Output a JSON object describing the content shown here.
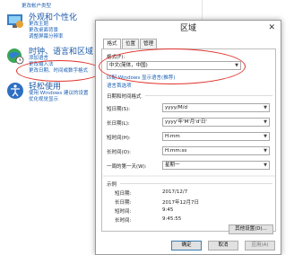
{
  "control_panel": {
    "top_link": "更改帐户类型",
    "appearance": {
      "title": "外观和个性化",
      "links": [
        "更改主题",
        "更改桌面背景",
        "调整屏幕分辨率"
      ]
    },
    "clock": {
      "title": "时钟、语言和区域",
      "links": [
        "添加语言",
        "更改输入法",
        "更改日期、时间或数字格式"
      ]
    },
    "ease": {
      "title": "轻松使用",
      "links": [
        "使用 Windows 建议的设置",
        "优化视觉显示"
      ]
    }
  },
  "dialog": {
    "title": "区域",
    "close_glyph": "✕",
    "tabs": [
      "格式",
      "位置",
      "管理"
    ],
    "format_label": "格式(F):",
    "format_value": "中文(简体，中国)",
    "match_link": "匹配 Windows 显示语言(推荐)",
    "lang_pref_link": "语言首选项",
    "datetime_group": "日期和时间格式",
    "fields": [
      {
        "label": "短日期(S):",
        "value": "yyyy/M/d"
      },
      {
        "label": "长日期(L):",
        "value": "yyyy'年'M'月'd'日'"
      },
      {
        "label": "短时间(H):",
        "value": "H:mm"
      },
      {
        "label": "长时间(O):",
        "value": "H:mm:ss"
      },
      {
        "label": "一周的第一天(W):",
        "value": "星期一"
      }
    ],
    "examples_group": "示例",
    "examples": [
      {
        "label": "短日期:",
        "value": "2017/12/7"
      },
      {
        "label": "长日期:",
        "value": "2017年12月7日"
      },
      {
        "label": "短时间:",
        "value": "9:45"
      },
      {
        "label": "长时间:",
        "value": "9:45:55"
      }
    ],
    "other_settings": "其他设置(D)...",
    "ok": "确定",
    "cancel": "取消",
    "apply": "应用(A)"
  },
  "colors": {
    "link": "#1a5fb4",
    "heading": "#1e5aa8",
    "annotation": "#e0322b"
  }
}
